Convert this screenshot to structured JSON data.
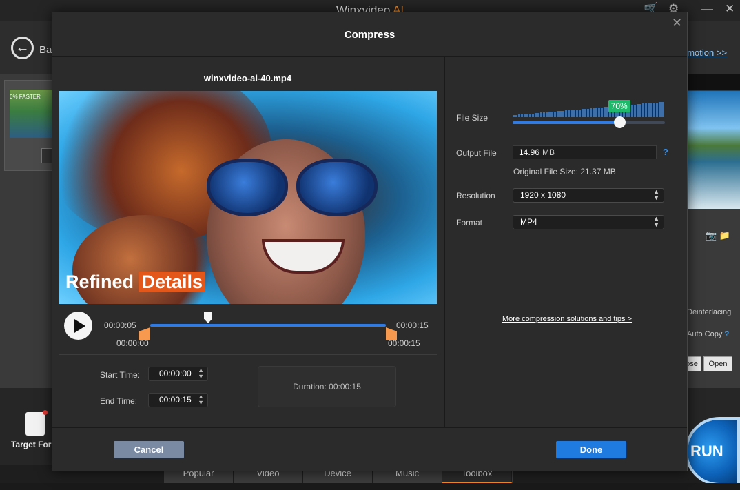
{
  "app": {
    "title": "Winxvideo",
    "title_accent": "AI",
    "back_label": "Ba",
    "promo_link": "omotion >>",
    "thumb_caption": "0% FASTER",
    "target_format_label": "Target For",
    "run_label": "RUN",
    "right_deinterlacing": "Deinterlacing",
    "right_auto_copy": "Auto Copy",
    "right_browse": "ose",
    "right_open": "Open",
    "tabs": [
      {
        "label": "Popular",
        "active": false
      },
      {
        "label": "Video",
        "active": false
      },
      {
        "label": "Device",
        "active": false
      },
      {
        "label": "Music",
        "active": false
      },
      {
        "label": "Toolbox",
        "active": true
      }
    ],
    "accent_color": "#f08a24",
    "icons": [
      "cart-icon",
      "gear-icon",
      "minimize-icon",
      "close-icon",
      "back-arrow-icon",
      "camera-icon",
      "folder-icon"
    ]
  },
  "dialog": {
    "title": "Compress",
    "file_name": "winxvideo-ai-40.mp4",
    "video_overlay": {
      "text_plain": "Refined",
      "text_highlight": "Details",
      "highlight_color": "#e4571b"
    },
    "player": {
      "current_time": "00:00:05",
      "end_time": "00:00:15",
      "trim_start_label": "00:00:00",
      "trim_end_label": "00:00:15"
    },
    "start_time": {
      "label": "Start Time:",
      "value": "00:00:00"
    },
    "end_time": {
      "label": "End Time:",
      "value": "00:00:15"
    },
    "duration_label": "Duration:",
    "duration_value": "00:00:15",
    "file_size": {
      "label": "File Size",
      "percent": 70,
      "badge": "70%",
      "badge_color": "#20b86a"
    },
    "output_file": {
      "label": "Output File",
      "value": "14.96",
      "unit": "MB",
      "help": "?"
    },
    "original_file_size": "Original File Size: 21.37 MB",
    "resolution": {
      "label": "Resolution",
      "value": "1920 x 1080"
    },
    "format": {
      "label": "Format",
      "value": "MP4"
    },
    "tips_link": "More compression solutions and tips >",
    "cancel_label": "Cancel",
    "done_label": "Done",
    "primary_color": "#1f7be0"
  }
}
